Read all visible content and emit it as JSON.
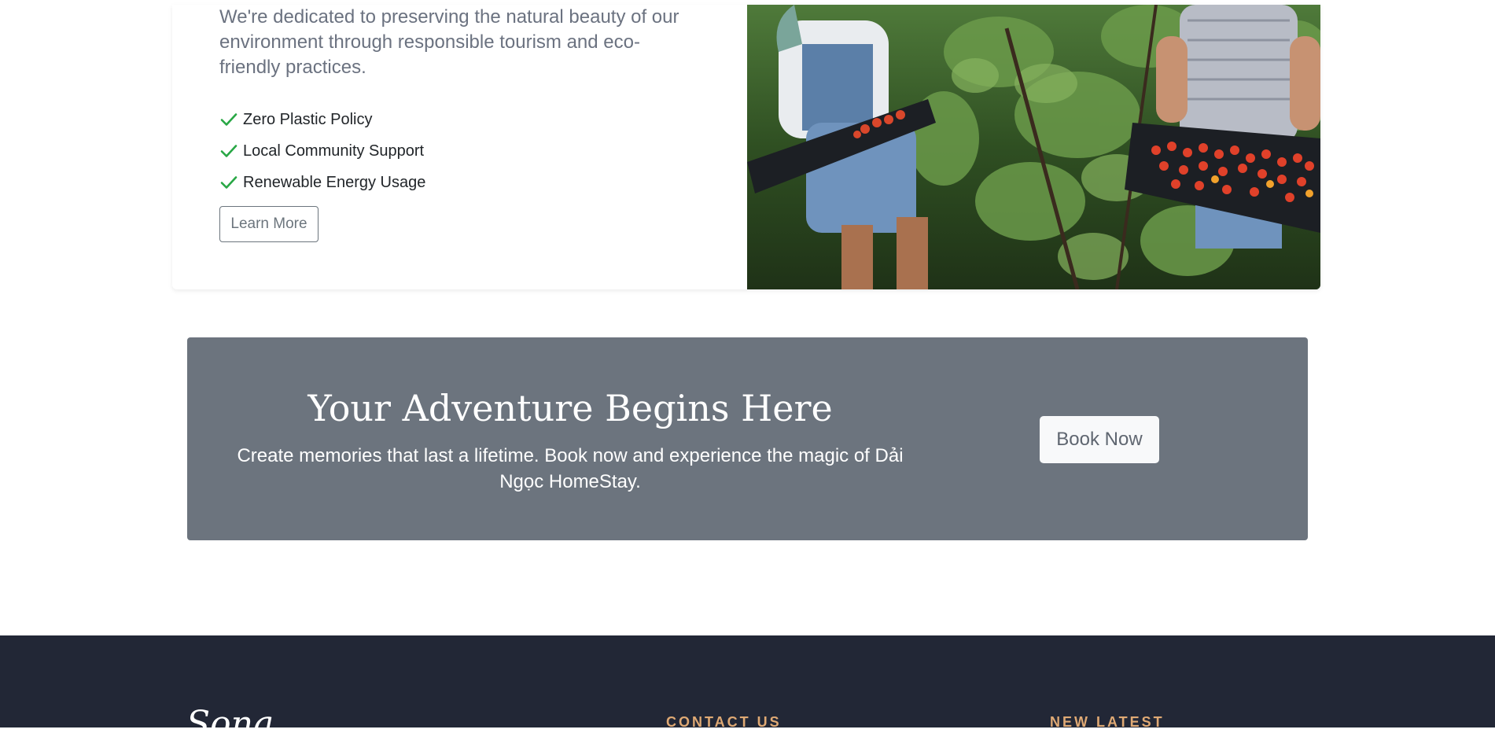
{
  "eco": {
    "description": "We're dedicated to preserving the natural beauty of our environment through responsible tourism and eco-friendly practices.",
    "features": [
      "Zero Plastic Policy",
      "Local Community Support",
      "Renewable Energy Usage"
    ],
    "learn_more_label": "Learn More",
    "check_color": "#28a745"
  },
  "cta": {
    "title": "Your Adventure Begins Here",
    "subtitle": "Create memories that last a lifetime. Book now and experience the magic of Dải Ngọc HomeStay.",
    "book_label": "Book Now",
    "background_color": "#6c747e"
  },
  "footer": {
    "logo": "Sona",
    "contact_heading": "CONTACT US",
    "latest_heading": "NEW LATEST",
    "background_color": "#222736",
    "accent_color": "#dfa974"
  }
}
